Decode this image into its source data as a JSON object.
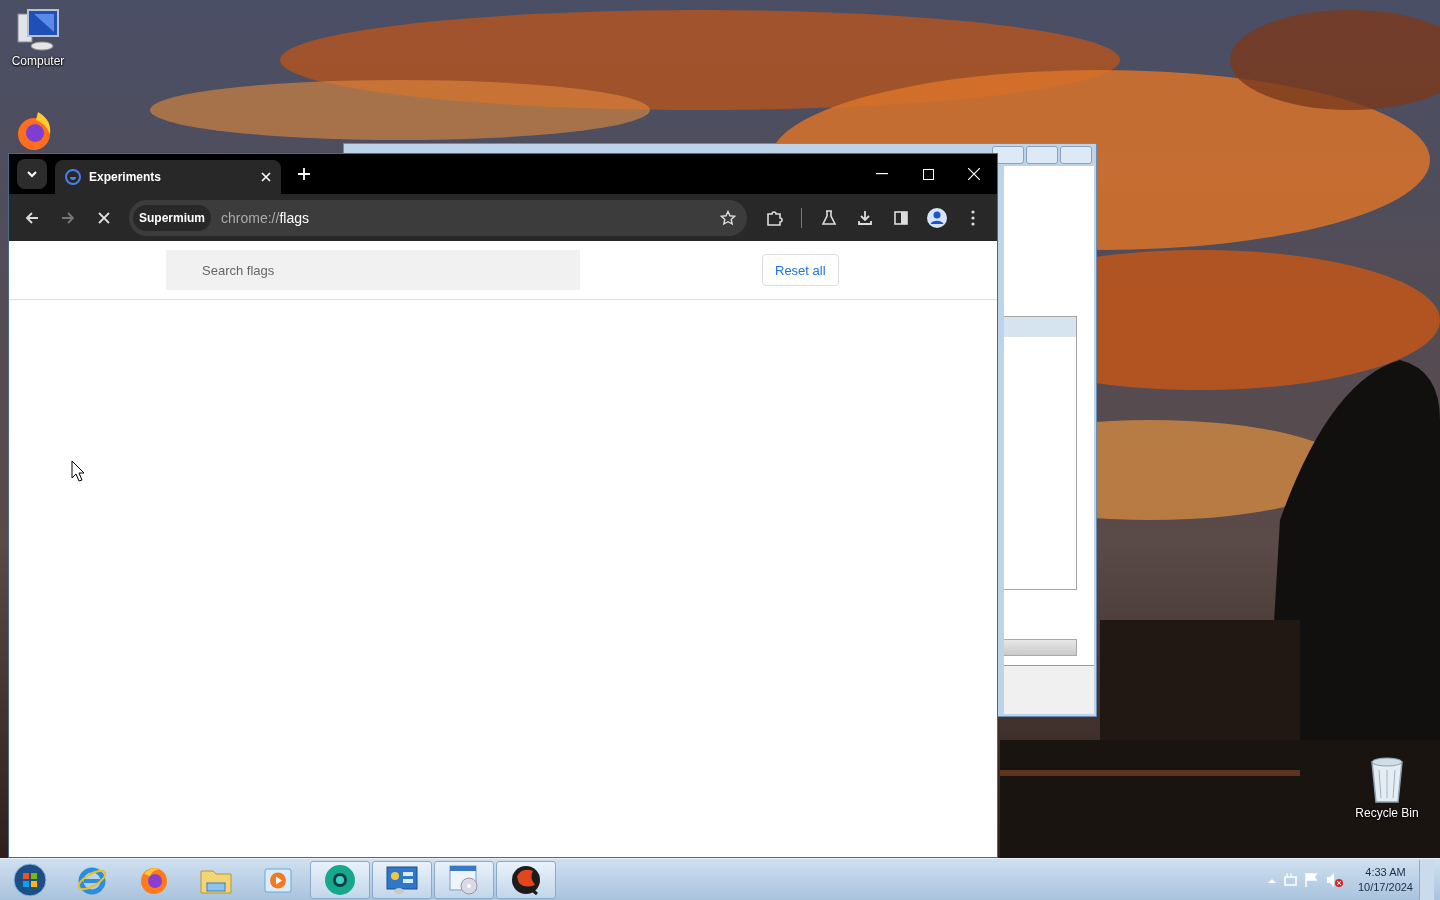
{
  "desktop": {
    "icons": [
      {
        "kind": "computer",
        "label": "Computer"
      },
      {
        "kind": "firefox"
      },
      {
        "kind": "recycle-bin",
        "label": "Recycle Bin"
      }
    ]
  },
  "browser": {
    "tab": {
      "title": "Experiments",
      "selected": true
    },
    "profile_chip": "Supermium",
    "url_scheme": "chrome://",
    "url_path": "flags",
    "loading": true,
    "search": {
      "placeholder": "Search flags"
    },
    "reset_button": "Reset all"
  },
  "taskbar": {
    "items": [
      {
        "kind": "start",
        "running": false
      },
      {
        "kind": "ie",
        "running": false
      },
      {
        "kind": "firefox",
        "running": false
      },
      {
        "kind": "folder",
        "running": false
      },
      {
        "kind": "media",
        "running": false
      },
      {
        "kind": "chromium",
        "running": true
      },
      {
        "kind": "control-panel",
        "running": true
      },
      {
        "kind": "installer",
        "running": true
      },
      {
        "kind": "qbittorrent",
        "running": true
      }
    ],
    "clock": {
      "time": "4:33 AM",
      "date": "10/17/2024"
    }
  }
}
